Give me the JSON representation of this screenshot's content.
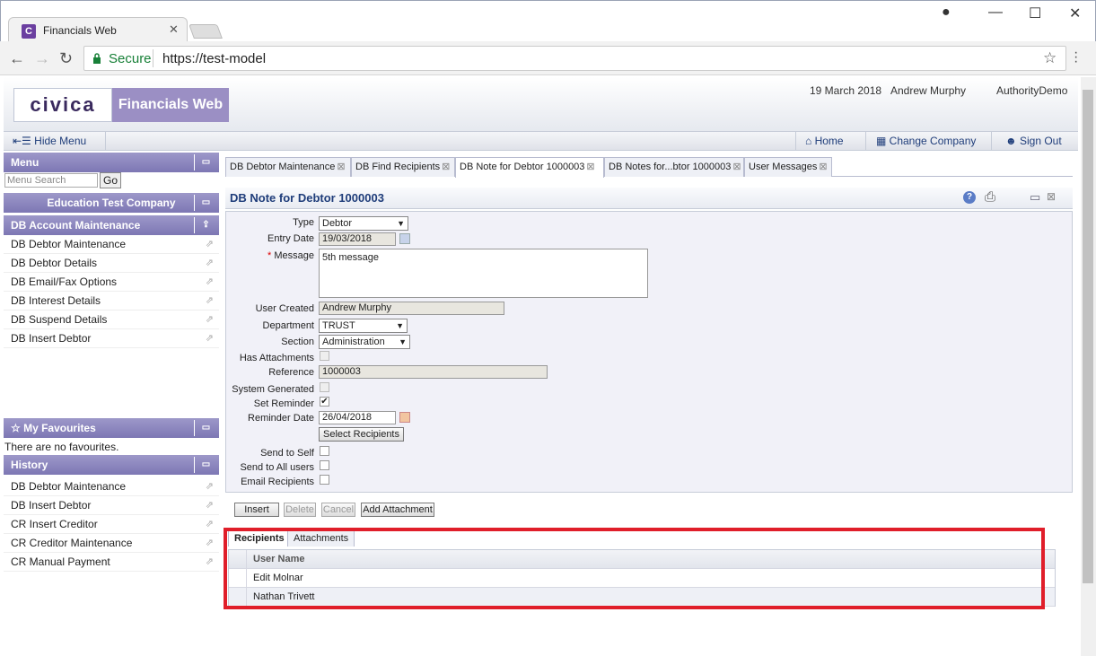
{
  "browser": {
    "tab_title": "Financials Web",
    "tab_icon": "C",
    "secure_label": "Secure",
    "url": "https://test-model"
  },
  "header": {
    "logo": "civica",
    "app_name": "Financials Web",
    "date": "19 March 2018",
    "user": "Andrew Murphy",
    "authority": "AuthorityDemo"
  },
  "menubar": {
    "hide_menu": "Hide Menu",
    "home": "Home",
    "change_company": "Change Company",
    "sign_out": "Sign Out"
  },
  "left_panel": {
    "menu_title": "Menu",
    "search_placeholder": "Menu Search",
    "go_label": "Go",
    "company": "Education Test Company",
    "section": "DB Account Maintenance",
    "items": [
      {
        "label": "DB Debtor Maintenance"
      },
      {
        "label": "DB Debtor Details"
      },
      {
        "label": "DB Email/Fax Options"
      },
      {
        "label": "DB Interest Details"
      },
      {
        "label": "DB Suspend Details"
      },
      {
        "label": "DB Insert Debtor"
      }
    ],
    "favourites_title": "My Favourites",
    "favourites_empty": "There are no favourites.",
    "history_title": "History",
    "history": [
      {
        "label": "DB Debtor Maintenance"
      },
      {
        "label": "DB Insert Debtor"
      },
      {
        "label": "CR Insert Creditor"
      },
      {
        "label": "CR Creditor Maintenance"
      },
      {
        "label": "CR Manual Payment"
      }
    ]
  },
  "tabs": [
    {
      "label": "DB Debtor Maintenance"
    },
    {
      "label": "DB Find Recipients"
    },
    {
      "label": "DB Note for Debtor 1000003"
    },
    {
      "label": "DB Notes for...btor 1000003"
    },
    {
      "label": "User Messages"
    }
  ],
  "form": {
    "title": "DB Note for Debtor 1000003",
    "type_label": "Type",
    "type_value": "Debtor",
    "entry_date_label": "Entry Date",
    "entry_date_value": "19/03/2018",
    "message_label": "Message",
    "message_value": "5th message",
    "user_created_label": "User Created",
    "user_created_value": "Andrew Murphy",
    "department_label": "Department",
    "department_value": "TRUST",
    "section_label": "Section",
    "section_value": "Administration",
    "has_attachments_label": "Has Attachments",
    "reference_label": "Reference",
    "reference_value": "1000003",
    "system_generated_label": "System Generated",
    "set_reminder_label": "Set Reminder",
    "reminder_date_label": "Reminder Date",
    "reminder_date_value": "26/04/2018",
    "select_recipients": "Select Recipients",
    "send_to_self_label": "Send to Self",
    "send_to_all_label": "Send to All users",
    "email_recipients_label": "Email Recipients"
  },
  "actions": {
    "insert": "Insert",
    "delete": "Delete",
    "cancel": "Cancel",
    "add_attachment": "Add Attachment"
  },
  "recipients": {
    "tab_recipients": "Recipients",
    "tab_attachments": "Attachments",
    "column_user_name": "User Name",
    "rows": [
      {
        "name": "Edit Molnar"
      },
      {
        "name": "Nathan Trivett"
      }
    ]
  }
}
